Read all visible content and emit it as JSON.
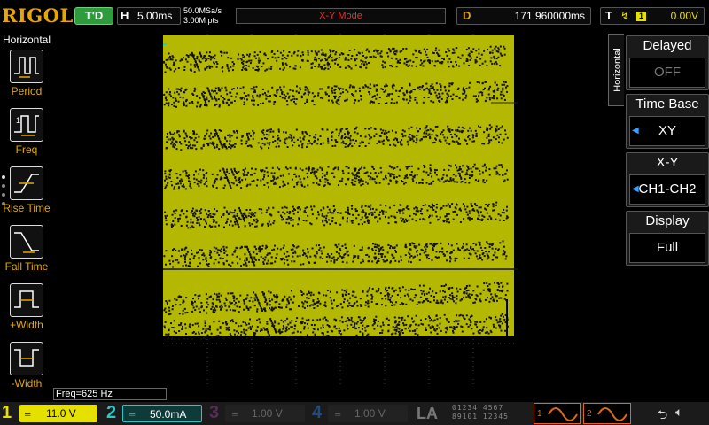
{
  "topbar": {
    "brand": "RIGOL",
    "trigger_status": "T'D",
    "horizontal_label": "H",
    "horizontal_scale": "5.00ms",
    "sample_rate": "50.0MSa/s",
    "memory_depth": "3.00M pts",
    "mode_title": "X-Y Mode",
    "delay_label": "D",
    "delay_value": "171.960000ms",
    "trigger_label": "T",
    "trigger_source": "1",
    "trigger_level": "0.00V"
  },
  "left_menu": {
    "title": "Horizontal",
    "items": [
      {
        "label": "Period",
        "icon": "period-icon"
      },
      {
        "label": "Freq",
        "icon": "freq-icon"
      },
      {
        "label": "Rise Time",
        "icon": "rise-time-icon"
      },
      {
        "label": "Fall Time",
        "icon": "fall-time-icon"
      },
      {
        "label": "+Width",
        "icon": "positive-width-icon"
      },
      {
        "label": "-Width",
        "icon": "negative-width-icon"
      }
    ]
  },
  "measurement": {
    "freq_readout": "Freq=625 Hz"
  },
  "right_menu": {
    "tab_label": "Horizontal",
    "items": [
      {
        "title": "Delayed",
        "value": "OFF"
      },
      {
        "title": "Time Base",
        "value": "XY"
      },
      {
        "title": "X-Y",
        "value": "CH1-CH2"
      },
      {
        "title": "Display",
        "value": "Full"
      }
    ]
  },
  "channels": [
    {
      "number": "1",
      "scale": "11.0 V",
      "color": "#e6e000",
      "coupling": "DC"
    },
    {
      "number": "2",
      "scale": "50.0mA",
      "color": "#28c8c8",
      "coupling": "DC"
    },
    {
      "number": "3",
      "scale": "1.00 V",
      "color": "#5a2a5a",
      "coupling": "DC"
    },
    {
      "number": "4",
      "scale": "1.00 V",
      "color": "#244a78",
      "coupling": "DC"
    }
  ],
  "logic_analyzer": {
    "label": "LA",
    "digits_row1": "01234 4567",
    "digits_row2": "89101 12345"
  },
  "generators": [
    {
      "number": "1",
      "waveform": "sine"
    },
    {
      "number": "2",
      "waveform": "sine"
    }
  ],
  "colors": {
    "trace": "#b5b800",
    "brand": "#e6a800",
    "accent_orange": "#e06a10"
  }
}
